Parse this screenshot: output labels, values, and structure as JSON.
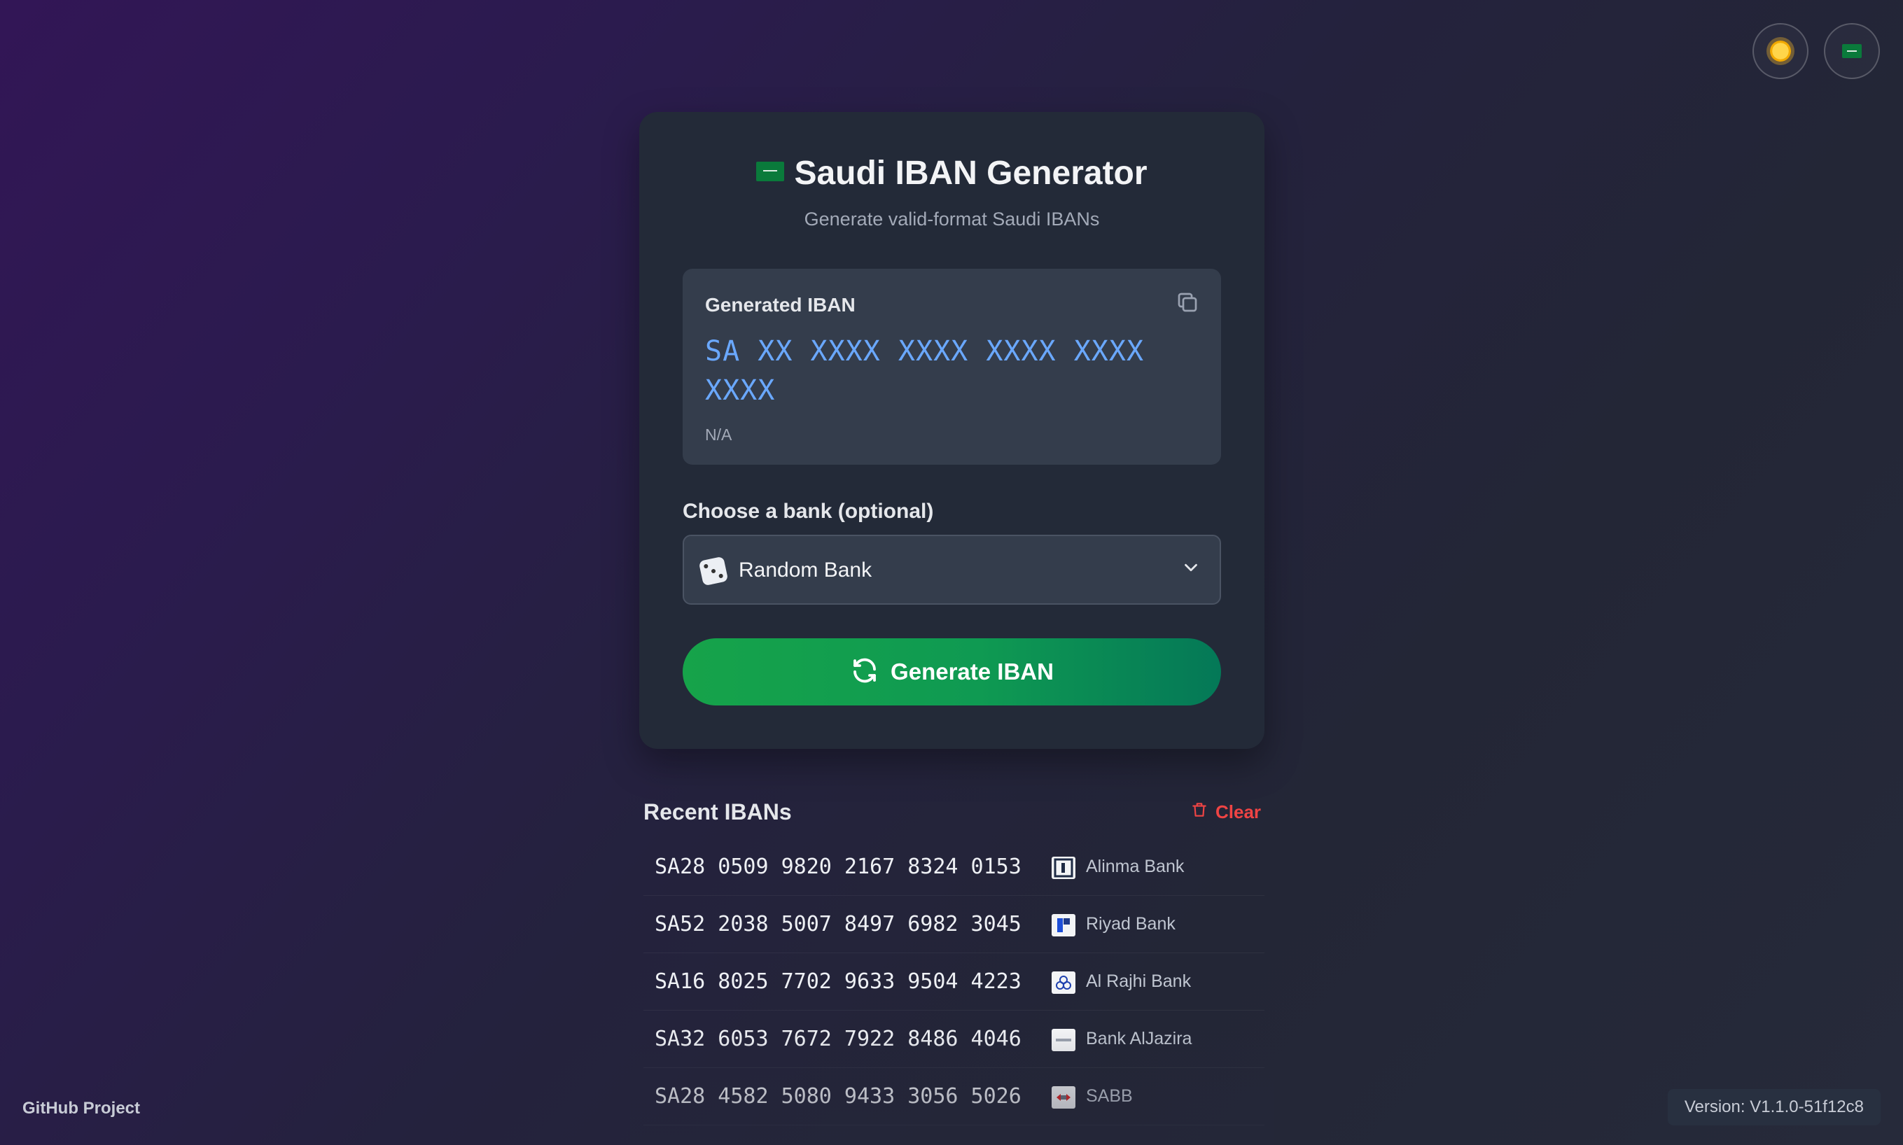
{
  "header_actions": {
    "theme_icon": "sun-icon",
    "language_icon": "saudi-flag-icon"
  },
  "card": {
    "title": "Saudi IBAN Generator",
    "subtitle": "Generate valid-format Saudi IBANs",
    "generated_label": "Generated IBAN",
    "generated_value": "SA XX XXXX XXXX XXXX XXXX XXXX",
    "generated_bank": "N/A",
    "choose_bank_label": "Choose a bank (optional)",
    "selected_bank": "Random Bank",
    "generate_button": "Generate IBAN"
  },
  "recent": {
    "title": "Recent IBANs",
    "clear_label": "Clear",
    "items": [
      {
        "iban": "SA28 0509 9820 2167 8324 0153",
        "bank": "Alinma Bank"
      },
      {
        "iban": "SA52 2038 5007 8497 6982 3045",
        "bank": "Riyad Bank"
      },
      {
        "iban": "SA16 8025 7702 9633 9504 4223",
        "bank": "Al Rajhi Bank"
      },
      {
        "iban": "SA32 6053 7672 7922 8486 4046",
        "bank": "Bank AlJazira"
      },
      {
        "iban": "SA28 4582 5080 9433 3056 5026",
        "bank": "SABB"
      }
    ]
  },
  "footer": {
    "github_link": "GitHub Project",
    "version": "Version: V1.1.0-51f12c8"
  },
  "colors": {
    "accent_green": "#16a34a",
    "iban_blue": "#6aa8ff",
    "danger_red": "#ef4444"
  }
}
